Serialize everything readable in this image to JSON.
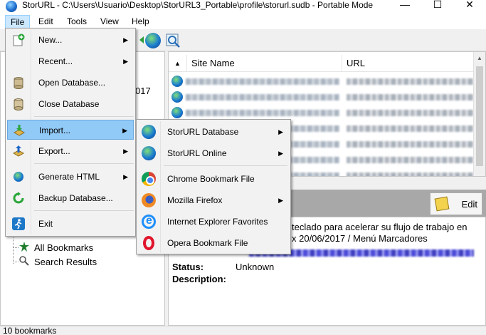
{
  "window": {
    "title": "StorURL - C:\\Users\\Usuario\\Desktop\\StorURL3_Portable\\profile\\storurl.sudb - Portable Mode",
    "minimize_glyph": "—",
    "maximize_glyph": "☐",
    "close_glyph": "✕"
  },
  "menubar": {
    "file": "File",
    "edit": "Edit",
    "tools": "Tools",
    "view": "View",
    "help": "Help"
  },
  "file_menu": {
    "new": "New...",
    "recent": "Recent...",
    "open_db": "Open Database...",
    "close_db": "Close Database",
    "import": "Import...",
    "export": "Export...",
    "generate_html": "Generate HTML",
    "backup_db": "Backup Database...",
    "exit": "Exit",
    "submenu_arrow": "▶"
  },
  "import_menu": {
    "storurl_db": "StorURL Database",
    "storurl_online": "StorURL Online",
    "chrome": "Chrome Bookmark File",
    "firefox": "Mozilla Firefox",
    "ie": "Internet Explorer Favorites",
    "opera": "Opera Bookmark File"
  },
  "left_pane": {
    "fragment": "017",
    "all_bookmarks": "All Bookmarks",
    "search_results": "Search Results"
  },
  "list": {
    "sort_glyph": "▲",
    "columns": {
      "site_name": "Site Name",
      "url": "URL"
    },
    "row_count": 7
  },
  "detail": {
    "edit_label": "Edit",
    "line1": "teclado para acelerar su flujo de trabajo en",
    "line2": "x 20/06/2017 / Menú Marcadores",
    "status_label": "Status:",
    "status_value": "Unknown",
    "description_label": "Description:"
  },
  "statusbar": {
    "text": "10 bookmarks"
  },
  "colors": {
    "menu_highlight": "#91c9f7",
    "menubar_open": "#cce8ff",
    "detail_header": "#a8a8a8"
  },
  "icons": [
    "app-globe-icon",
    "new-db-icon",
    "open-db-icon",
    "close-db-icon",
    "import-icon",
    "export-icon",
    "html-globe-icon",
    "backup-icon",
    "exit-runner-icon",
    "chrome-icon",
    "firefox-icon",
    "ie-icon",
    "opera-icon",
    "star-icon",
    "search-icon",
    "edit-note-icon"
  ]
}
